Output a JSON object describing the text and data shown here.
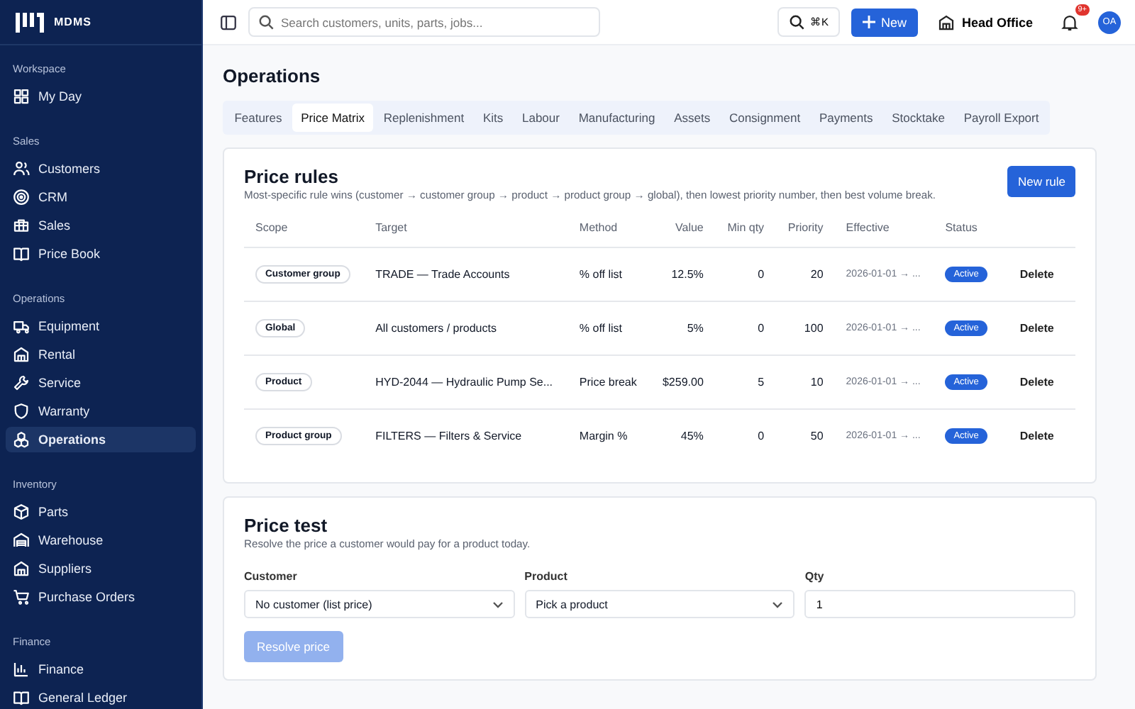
{
  "sidebar": {
    "logo": "MDMS",
    "sections": [
      {
        "title": "Workspace",
        "items": [
          {
            "label": "My Day",
            "selected": false
          }
        ]
      },
      {
        "title": "Sales",
        "items": [
          {
            "label": "Customers",
            "selected": false
          },
          {
            "label": "CRM",
            "selected": false
          },
          {
            "label": "Sales",
            "selected": false
          },
          {
            "label": "Price Book",
            "selected": false
          }
        ]
      },
      {
        "title": "Operations",
        "items": [
          {
            "label": "Equipment",
            "selected": false
          },
          {
            "label": "Rental",
            "selected": false
          },
          {
            "label": "Service",
            "selected": false
          },
          {
            "label": "Warranty",
            "selected": false
          },
          {
            "label": "Operations",
            "selected": true
          }
        ]
      },
      {
        "title": "Inventory",
        "items": [
          {
            "label": "Parts",
            "selected": false
          },
          {
            "label": "Warehouse",
            "selected": false
          },
          {
            "label": "Suppliers",
            "selected": false
          },
          {
            "label": "Purchase Orders",
            "selected": false
          }
        ]
      },
      {
        "title": "Finance",
        "items": [
          {
            "label": "Finance",
            "selected": false
          },
          {
            "label": "General Ledger",
            "selected": false
          }
        ]
      }
    ]
  },
  "topbar": {
    "search": {
      "placeholder": "Search customers, units, parts, jobs..."
    },
    "shortcut": "⌘K",
    "new_button": "New",
    "branch": "Head Office",
    "notification_badge": "9+",
    "avatar": "OA"
  },
  "page_title": "Operations",
  "tabs": [
    {
      "label": "Features",
      "selected": false
    },
    {
      "label": "Price Matrix",
      "selected": true
    },
    {
      "label": "Replenishment",
      "selected": false
    },
    {
      "label": "Kits",
      "selected": false
    },
    {
      "label": "Labour",
      "selected": false
    },
    {
      "label": "Manufacturing",
      "selected": false
    },
    {
      "label": "Assets",
      "selected": false
    },
    {
      "label": "Consignment",
      "selected": false
    },
    {
      "label": "Payments",
      "selected": false
    },
    {
      "label": "Stocktake",
      "selected": false
    },
    {
      "label": "Payroll Export",
      "selected": false
    }
  ],
  "price_rules": {
    "title": "Price rules",
    "description": "Most-specific rule wins (customer → customer group → product → product group → global), then lowest priority number, then best volume break.",
    "new_button": "New rule",
    "columns": [
      "Scope",
      "Target",
      "Method",
      "Value",
      "Min qty",
      "Priority",
      "Effective",
      "Status"
    ],
    "rows": [
      {
        "scope": "Customer group",
        "target": "TRADE — Trade Accounts",
        "method": "% off list",
        "value": "12.5%",
        "min_qty": "0",
        "priority": "20",
        "effective": "2026-01-01 → ...",
        "status": "Active",
        "action": "Delete"
      },
      {
        "scope": "Global",
        "target": "All customers / products",
        "method": "% off list",
        "value": "5%",
        "min_qty": "0",
        "priority": "100",
        "effective": "2026-01-01 → ...",
        "status": "Active",
        "action": "Delete"
      },
      {
        "scope": "Product",
        "target": "HYD-2044 — Hydraulic Pump Se...",
        "method": "Price break",
        "value": "$259.00",
        "min_qty": "5",
        "priority": "10",
        "effective": "2026-01-01 → ...",
        "status": "Active",
        "action": "Delete"
      },
      {
        "scope": "Product group",
        "target": "FILTERS — Filters & Service",
        "method": "Margin %",
        "value": "45%",
        "min_qty": "0",
        "priority": "50",
        "effective": "2026-01-01 → ...",
        "status": "Active",
        "action": "Delete"
      }
    ]
  },
  "price_test": {
    "title": "Price test",
    "description": "Resolve the price a customer would pay for a product today.",
    "customer": {
      "label": "Customer",
      "value": "No customer (list price)"
    },
    "product": {
      "label": "Product",
      "placeholder": "Pick a product"
    },
    "qty": {
      "label": "Qty",
      "value": "1"
    },
    "resolve_button": {
      "label": "Resolve price",
      "disabled": true
    }
  }
}
